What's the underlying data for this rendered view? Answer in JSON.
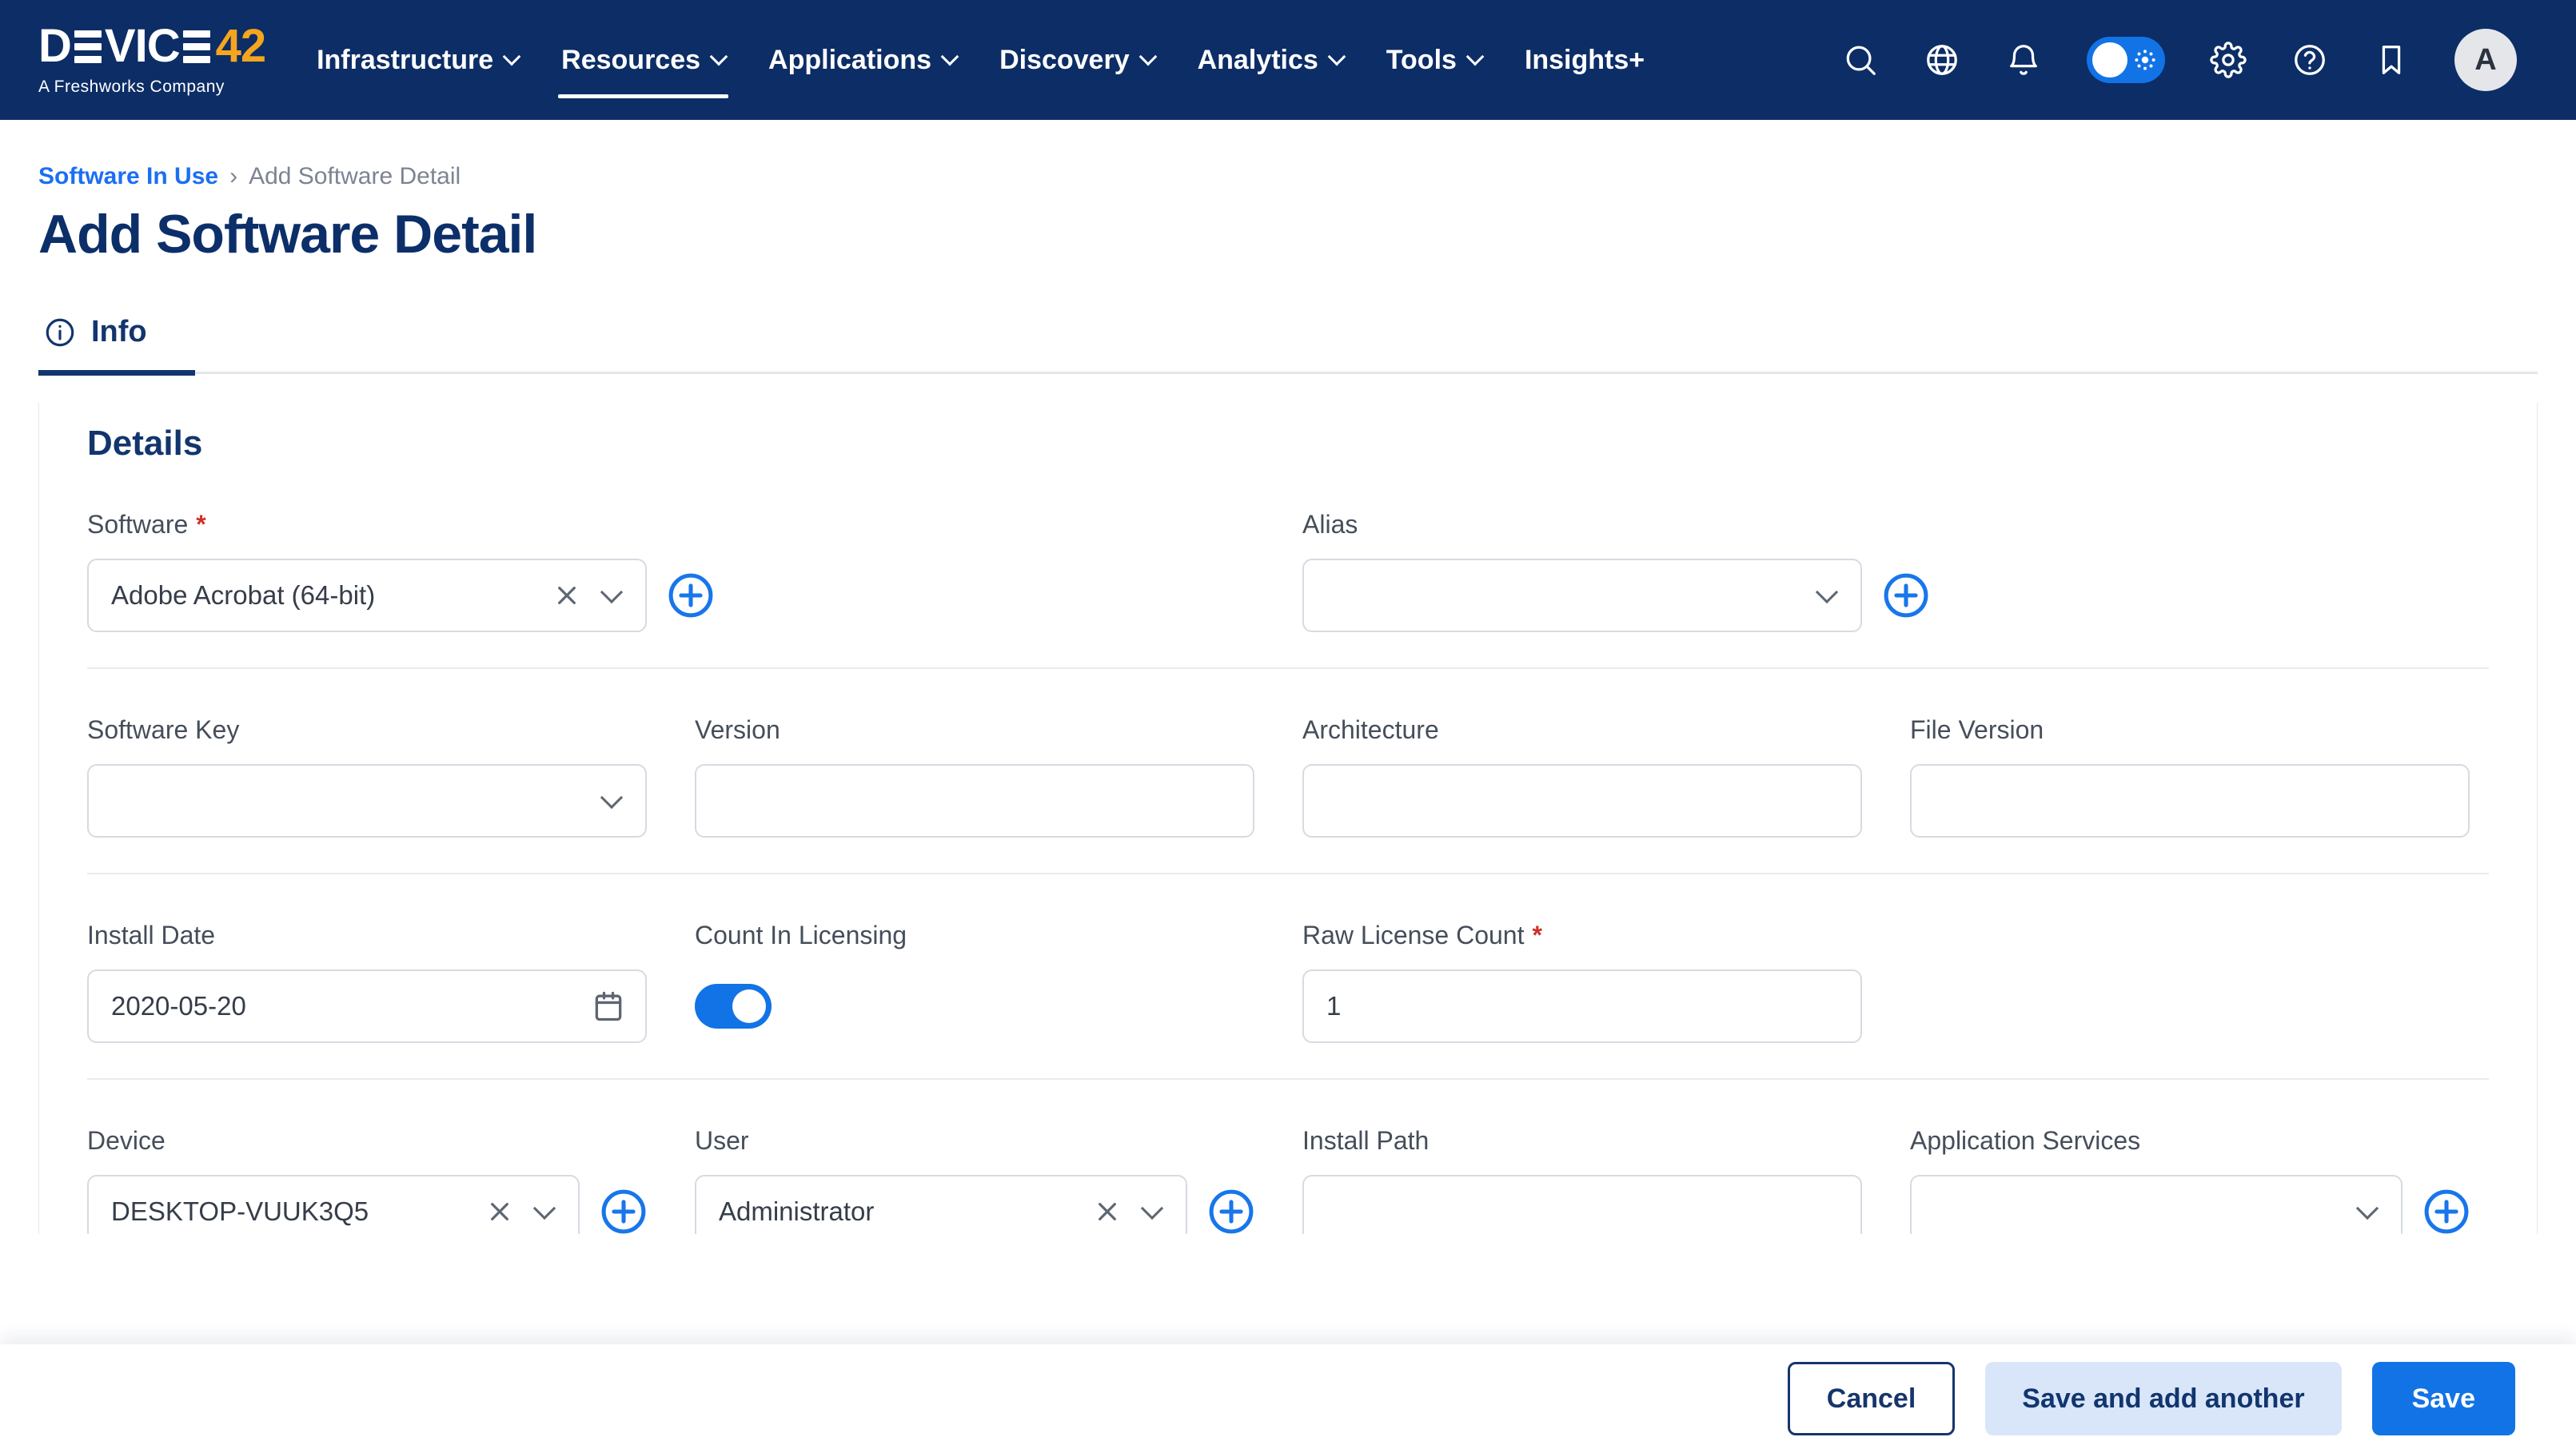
{
  "ui": {
    "required_marker": "*"
  },
  "colors": {
    "header_navy": "#0d2d66",
    "accent_blue": "#1273e6",
    "link_blue": "#1b6ff2",
    "brand_orange": "#f6a51f",
    "required_red": "#d03028",
    "save_add_bg": "#d9e6f9"
  },
  "header": {
    "logo": {
      "part1": "D",
      "part2": "VIC",
      "suffix": "42",
      "tagline": "A Freshworks Company"
    },
    "nav": [
      {
        "label": "Infrastructure"
      },
      {
        "label": "Resources"
      },
      {
        "label": "Applications"
      },
      {
        "label": "Discovery"
      },
      {
        "label": "Analytics"
      },
      {
        "label": "Tools"
      },
      {
        "label": "Insights+"
      }
    ],
    "active_nav": "Resources",
    "icons": [
      "search-icon",
      "globe-icon",
      "bell-icon",
      "theme-toggle",
      "settings-icon",
      "help-icon",
      "bookmark-icon"
    ],
    "theme_toggle_on": true,
    "avatar": "A"
  },
  "breadcrumb": {
    "parent": "Software In Use",
    "separator": "›",
    "current": "Add Software Detail"
  },
  "page": {
    "title": "Add Software Detail"
  },
  "tabs": [
    {
      "label": "Info",
      "active": true
    }
  ],
  "section": {
    "title": "Details"
  },
  "fields": {
    "software": {
      "label": "Software",
      "required": true,
      "type": "select",
      "value": "Adobe Acrobat (64-bit)",
      "clearable": true,
      "addable": true
    },
    "alias": {
      "label": "Alias",
      "type": "select",
      "value": "",
      "addable": true
    },
    "software_key": {
      "label": "Software Key",
      "type": "select",
      "value": ""
    },
    "version": {
      "label": "Version",
      "type": "text",
      "value": ""
    },
    "architecture": {
      "label": "Architecture",
      "type": "text",
      "value": ""
    },
    "file_version": {
      "label": "File Version",
      "type": "text",
      "value": ""
    },
    "install_date": {
      "label": "Install Date",
      "type": "date",
      "value": "2020-05-20"
    },
    "count_in_licensing": {
      "label": "Count In Licensing",
      "type": "toggle",
      "value": true
    },
    "raw_license_count": {
      "label": "Raw License Count",
      "required": true,
      "type": "text",
      "value": "1"
    },
    "device": {
      "label": "Device",
      "type": "select",
      "value": "DESKTOP-VUUK3Q5",
      "clearable": true,
      "addable": true
    },
    "user": {
      "label": "User",
      "type": "select",
      "value": "Administrator",
      "clearable": true,
      "addable": true
    },
    "install_path": {
      "label": "Install Path",
      "type": "text",
      "value": ""
    },
    "application_services": {
      "label": "Application Services",
      "type": "select",
      "value": "",
      "addable": true
    }
  },
  "footer": {
    "cancel_label": "Cancel",
    "save_add_label": "Save and add another",
    "save_label": "Save"
  }
}
